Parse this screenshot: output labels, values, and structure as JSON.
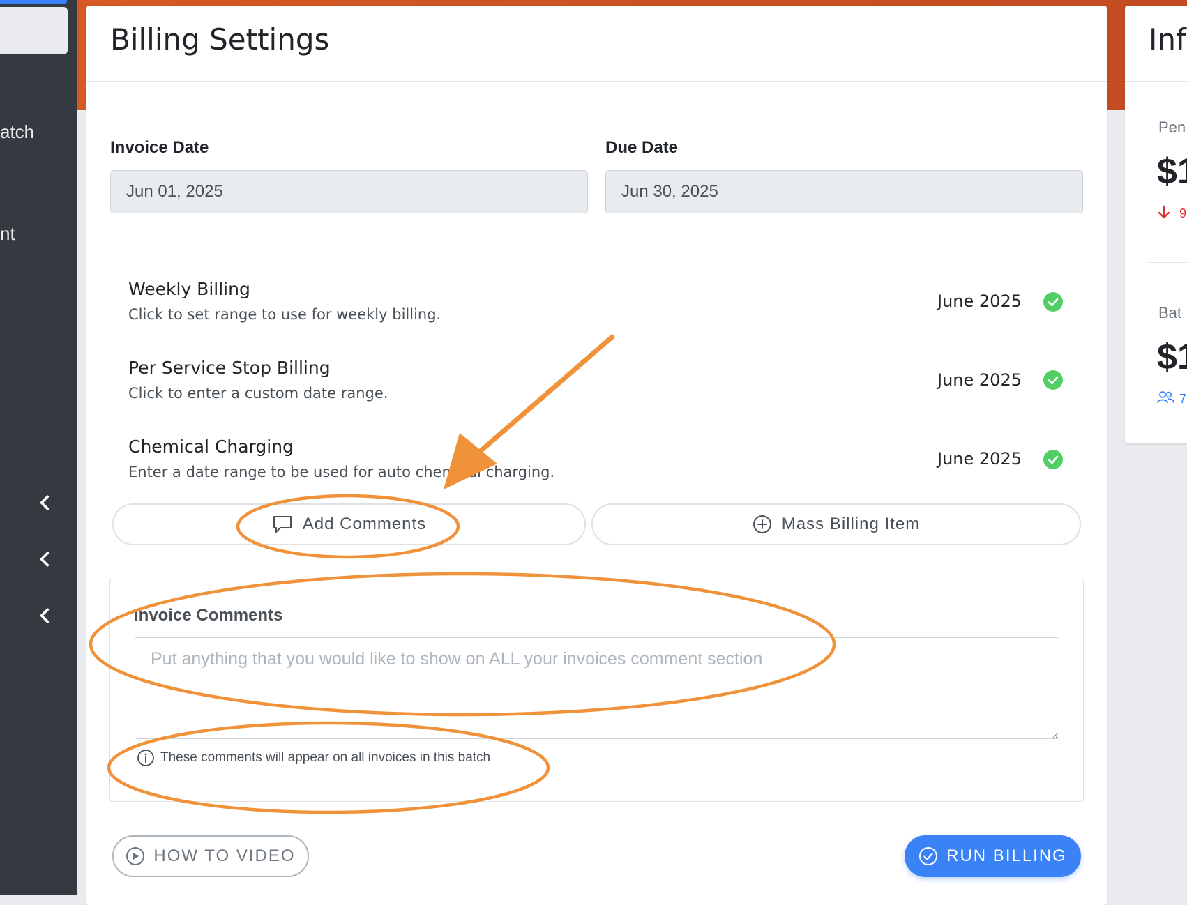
{
  "sidebar": {
    "items": [
      {
        "label": "atch"
      },
      {
        "label": "nt"
      }
    ],
    "chevrons": [
      "chevron-left-icon",
      "chevron-left-icon",
      "chevron-left-icon"
    ]
  },
  "main": {
    "title": "Billing Settings",
    "invoice_date": {
      "label": "Invoice Date",
      "value": "Jun 01, 2025"
    },
    "due_date": {
      "label": "Due Date",
      "value": "Jun 30, 2025"
    },
    "billing_rows": [
      {
        "title": "Weekly Billing",
        "desc": "Click to set range to use for weekly billing.",
        "month": "June 2025",
        "status_icon": "check-circle-icon"
      },
      {
        "title": "Per Service Stop Billing",
        "desc": "Click to enter a custom date range.",
        "month": "June 2025",
        "status_icon": "check-circle-icon"
      },
      {
        "title": "Chemical Charging",
        "desc": "Enter a date range to be used for auto chemical charging.",
        "month": "June 2025",
        "status_icon": "check-circle-icon"
      }
    ],
    "add_comments_label": "Add Comments",
    "mass_billing_label": "Mass Billing Item",
    "comments": {
      "label": "Invoice Comments",
      "placeholder": "Put anything that you would like to show on ALL your invoices comment section",
      "help": "These comments will appear on all invoices in this batch"
    },
    "how_to_video_label": "HOW TO VIDEO",
    "run_billing_label": "RUN BILLING"
  },
  "right_panel": {
    "title": "Info",
    "stat1": {
      "label": "Pen",
      "value": "$1",
      "sub": "9"
    },
    "stat2": {
      "label": "Bat",
      "value": "$1",
      "sub": "7"
    }
  },
  "colors": {
    "accent": "#3b82f6",
    "header_band": "#d65a26",
    "sidebar": "#343a40",
    "success": "#51cf66",
    "annotation": "#f0923a",
    "danger": "#e03131"
  }
}
